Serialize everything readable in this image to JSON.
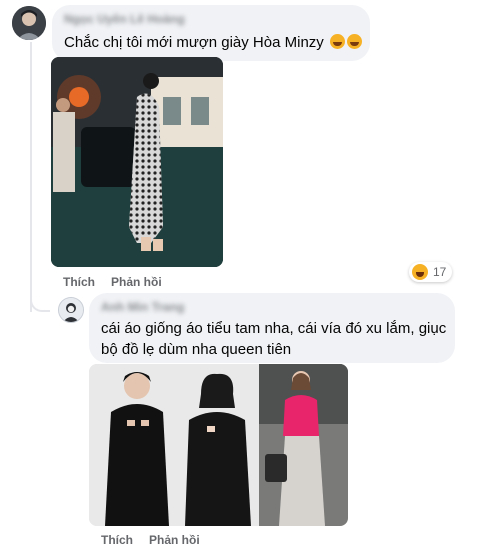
{
  "comment1": {
    "text": "Chắc chị tôi mới mượn giày Hòa Minzy",
    "emojis": [
      "rolling-laughing-emoji",
      "rolling-laughing-emoji"
    ],
    "actions": {
      "like": "Thích",
      "reply": "Phản hồi"
    },
    "reaction": {
      "icon": "haha-reaction-icon",
      "count": "17"
    }
  },
  "comment2": {
    "text": "cái áo giống áo tiểu tam nha, cái vía đó xu lắm, giục bộ đồ lẹ dùm nha queen tiên",
    "actions": {
      "like": "Thích",
      "reply": "Phản hồi"
    }
  },
  "colors": {
    "bubble": "#f0f2f5",
    "action_text": "#65676b",
    "reaction_face": "#f7b125",
    "pink_top": "#e8246a"
  }
}
